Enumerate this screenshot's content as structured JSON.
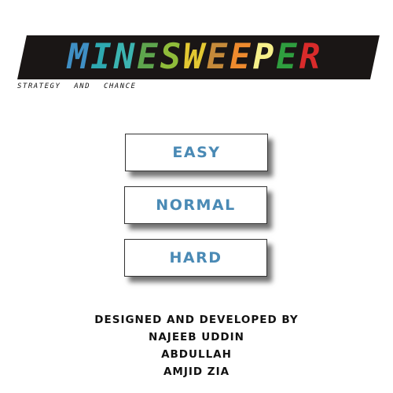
{
  "title": {
    "letters": [
      {
        "char": "M",
        "color": "#3f8fc4"
      },
      {
        "char": "I",
        "color": "#2ea9b0"
      },
      {
        "char": "N",
        "color": "#3cb4b0"
      },
      {
        "char": "E",
        "color": "#5ea54d"
      },
      {
        "char": "S",
        "color": "#8fbc3a"
      },
      {
        "char": "W",
        "color": "#e3c832"
      },
      {
        "char": "E",
        "color": "#c58a3a"
      },
      {
        "char": "E",
        "color": "#ee8a2e"
      },
      {
        "char": "P",
        "color": "#f6f08a"
      },
      {
        "char": "E",
        "color": "#2f9e3f"
      },
      {
        "char": "R",
        "color": "#d92b2b"
      }
    ],
    "tagline": "STRATEGY AND CHANCE"
  },
  "menu": {
    "easy": "EASY",
    "normal": "NORMAL",
    "hard": "HARD"
  },
  "credits": {
    "line1": "DESIGNED AND DEVELOPED BY",
    "line2": "NAJEEB UDDIN",
    "line3": "ABDULLAH",
    "line4": "AMJID ZIA"
  }
}
